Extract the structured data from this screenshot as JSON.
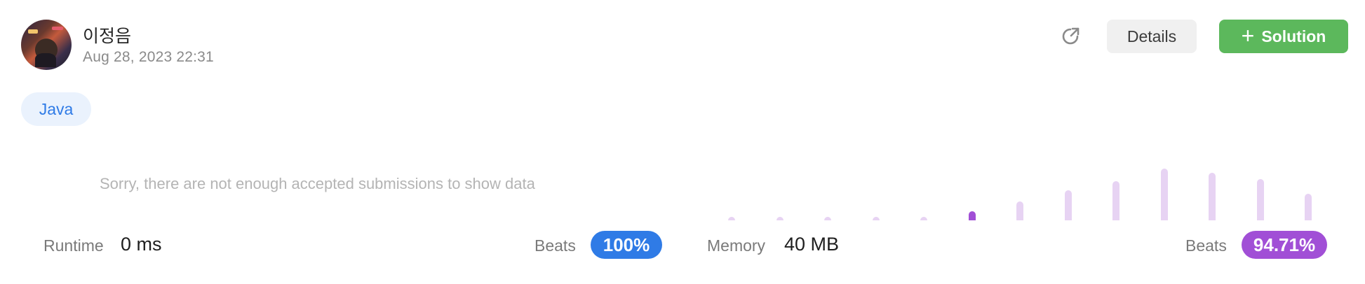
{
  "user": {
    "name": "이정음",
    "date": "Aug 28, 2023 22:31"
  },
  "actions": {
    "details_label": "Details",
    "solution_label": "Solution"
  },
  "language": "Java",
  "runtime_chart": {
    "empty_message": "Sorry, there are not enough accepted submissions to show data"
  },
  "memory_chart": {
    "bars": [
      0.04,
      0.04,
      0.04,
      0.04,
      0.04,
      0.14,
      0.3,
      0.48,
      0.62,
      0.82,
      0.76,
      0.66,
      0.42
    ],
    "active_index": 5
  },
  "stats": {
    "runtime_label": "Runtime",
    "runtime_value": "0 ms",
    "runtime_beats_label": "Beats",
    "runtime_beats_value": "100%",
    "memory_label": "Memory",
    "memory_value": "40 MB",
    "memory_beats_label": "Beats",
    "memory_beats_value": "94.71%"
  },
  "colors": {
    "accent_blue": "#2f7be6",
    "accent_purple": "#a14fd6",
    "solution_green": "#5cb85c"
  }
}
